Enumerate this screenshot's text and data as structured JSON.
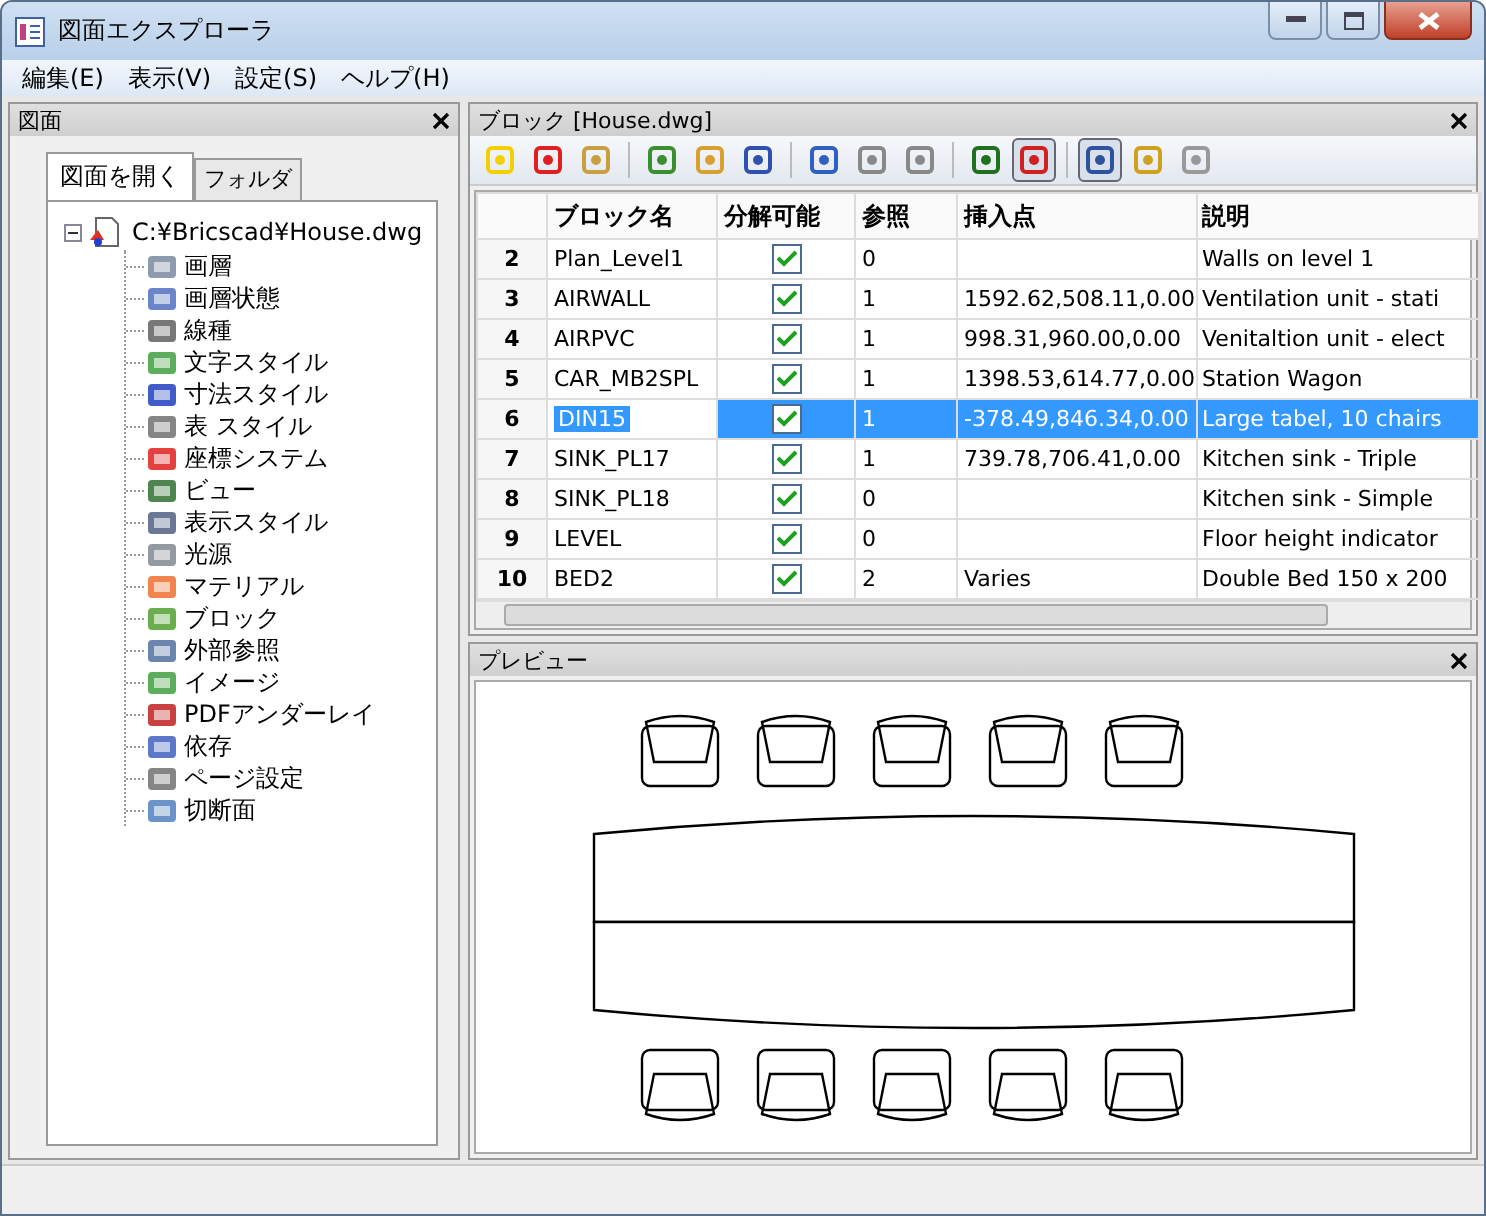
{
  "window": {
    "title": "図面エクスプローラ"
  },
  "menu": [
    "編集(E)",
    "表示(V)",
    "設定(S)",
    "ヘルプ(H)"
  ],
  "left_panel": {
    "title": "図面",
    "tabs": [
      {
        "label": "図面を開く",
        "selected": true
      },
      {
        "label": "フォルダ",
        "selected": false
      }
    ],
    "tree": {
      "label": "C:¥Bricscad¥House.dwg",
      "expanded": true,
      "children": [
        {
          "label": "画層"
        },
        {
          "label": "画層状態"
        },
        {
          "label": "線種"
        },
        {
          "label": "文字スタイル"
        },
        {
          "label": "寸法スタイル"
        },
        {
          "label": "表 スタイル"
        },
        {
          "label": "座標システム"
        },
        {
          "label": "ビュー"
        },
        {
          "label": "表示スタイル"
        },
        {
          "label": "光源"
        },
        {
          "label": "マテリアル"
        },
        {
          "label": "ブロック"
        },
        {
          "label": "外部参照"
        },
        {
          "label": "イメージ"
        },
        {
          "label": "PDFアンダーレイ"
        },
        {
          "label": "依存"
        },
        {
          "label": "ページ設定"
        },
        {
          "label": "切断面"
        }
      ]
    }
  },
  "blocks_panel": {
    "title": "ブロック [House.dwg]",
    "toolbar": [
      {
        "kind": "button",
        "pressed": false
      },
      {
        "kind": "button",
        "pressed": false
      },
      {
        "kind": "button",
        "pressed": false
      },
      {
        "kind": "separator"
      },
      {
        "kind": "button",
        "pressed": false
      },
      {
        "kind": "button",
        "pressed": false
      },
      {
        "kind": "button",
        "pressed": false
      },
      {
        "kind": "separator"
      },
      {
        "kind": "button",
        "pressed": false
      },
      {
        "kind": "button",
        "pressed": false
      },
      {
        "kind": "button",
        "pressed": false
      },
      {
        "kind": "separator"
      },
      {
        "kind": "button",
        "pressed": false
      },
      {
        "kind": "button",
        "pressed": true
      },
      {
        "kind": "separator"
      },
      {
        "kind": "button",
        "pressed": true
      },
      {
        "kind": "button",
        "pressed": false
      },
      {
        "kind": "button",
        "pressed": false
      }
    ],
    "table": {
      "columns": [
        "ブロック名",
        "分解可能",
        "参照",
        "挿入点",
        "説明"
      ],
      "rows": [
        {
          "number": "2",
          "name": "Plan_Level1",
          "explodable": true,
          "references": "0",
          "insertion_point": "",
          "description": "Walls on level 1",
          "selected": false
        },
        {
          "number": "3",
          "name": "AIRWALL",
          "explodable": true,
          "references": "1",
          "insertion_point": "1592.62,508.11,0.00",
          "description": "Ventilation unit - stati",
          "selected": false
        },
        {
          "number": "4",
          "name": "AIRPVC",
          "explodable": true,
          "references": "1",
          "insertion_point": "998.31,960.00,0.00",
          "description": "Venitaltion unit - elect",
          "selected": false
        },
        {
          "number": "5",
          "name": "CAR_MB2SPL",
          "explodable": true,
          "references": "1",
          "insertion_point": "1398.53,614.77,0.00",
          "description": "Station Wagon",
          "selected": false
        },
        {
          "number": "6",
          "name": "DIN15",
          "explodable": true,
          "references": "1",
          "insertion_point": "-378.49,846.34,0.00",
          "description": "Large tabel, 10 chairs",
          "selected": true
        },
        {
          "number": "7",
          "name": "SINK_PL17",
          "explodable": true,
          "references": "1",
          "insertion_point": "739.78,706.41,0.00",
          "description": "Kitchen sink - Triple",
          "selected": false
        },
        {
          "number": "8",
          "name": "SINK_PL18",
          "explodable": true,
          "references": "0",
          "insertion_point": "",
          "description": "Kitchen sink - Simple",
          "selected": false
        },
        {
          "number": "9",
          "name": "LEVEL",
          "explodable": true,
          "references": "0",
          "insertion_point": "",
          "description": "Floor height indicator",
          "selected": false
        },
        {
          "number": "10",
          "name": "BED2",
          "explodable": true,
          "references": "2",
          "insertion_point": "Varies",
          "description": "Double Bed 150 x 200",
          "selected": false
        }
      ]
    }
  },
  "preview_panel": {
    "title": "プレビュー"
  }
}
